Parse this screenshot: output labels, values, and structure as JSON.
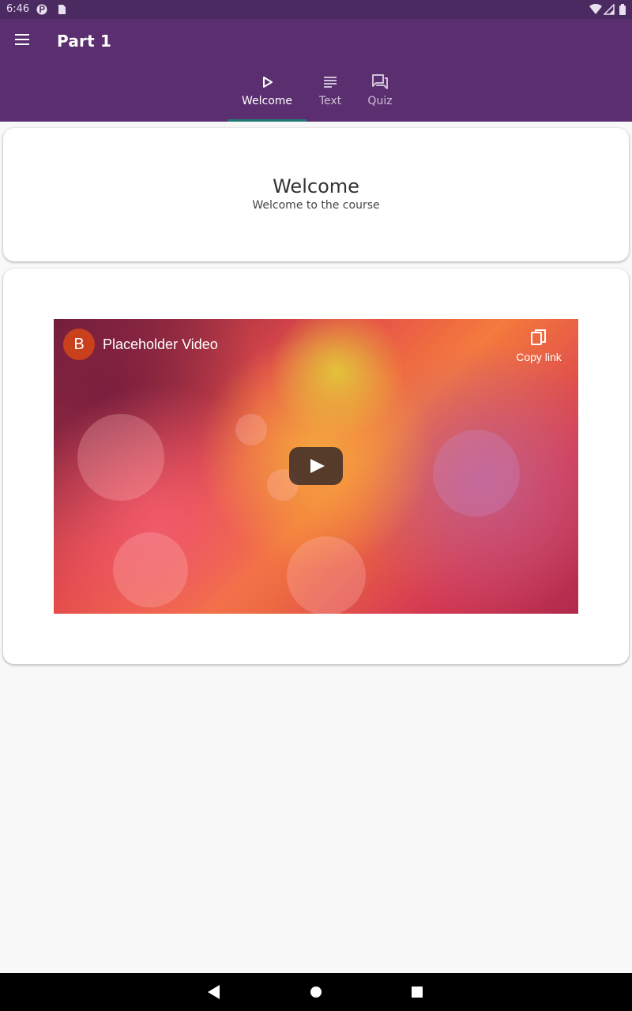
{
  "status_bar": {
    "time": "6:46",
    "icons": [
      "notification-icon",
      "sd-card-icon",
      "wifi-icon",
      "signal-icon",
      "battery-icon"
    ]
  },
  "app_bar": {
    "title": "Part 1",
    "menu_icon": "menu-icon"
  },
  "tabs": [
    {
      "label": "Welcome",
      "icon": "play-icon",
      "active": true
    },
    {
      "label": "Text",
      "icon": "text-lines-icon",
      "active": false
    },
    {
      "label": "Quiz",
      "icon": "forum-icon",
      "active": false
    }
  ],
  "welcome_card": {
    "title": "Welcome",
    "subtitle": "Welcome to the course"
  },
  "video": {
    "channel_initial": "B",
    "title": "Placeholder Video",
    "copy_link_label": "Copy link"
  },
  "colors": {
    "app_bar": "#5b2e6f",
    "status_bar": "#4b2a62",
    "tab_indicator": "#1f7a74",
    "background": "#f8f8f8",
    "avatar": "#c8401c"
  },
  "nav_bar": {
    "buttons": [
      "back-icon",
      "home-icon",
      "recents-icon"
    ]
  }
}
